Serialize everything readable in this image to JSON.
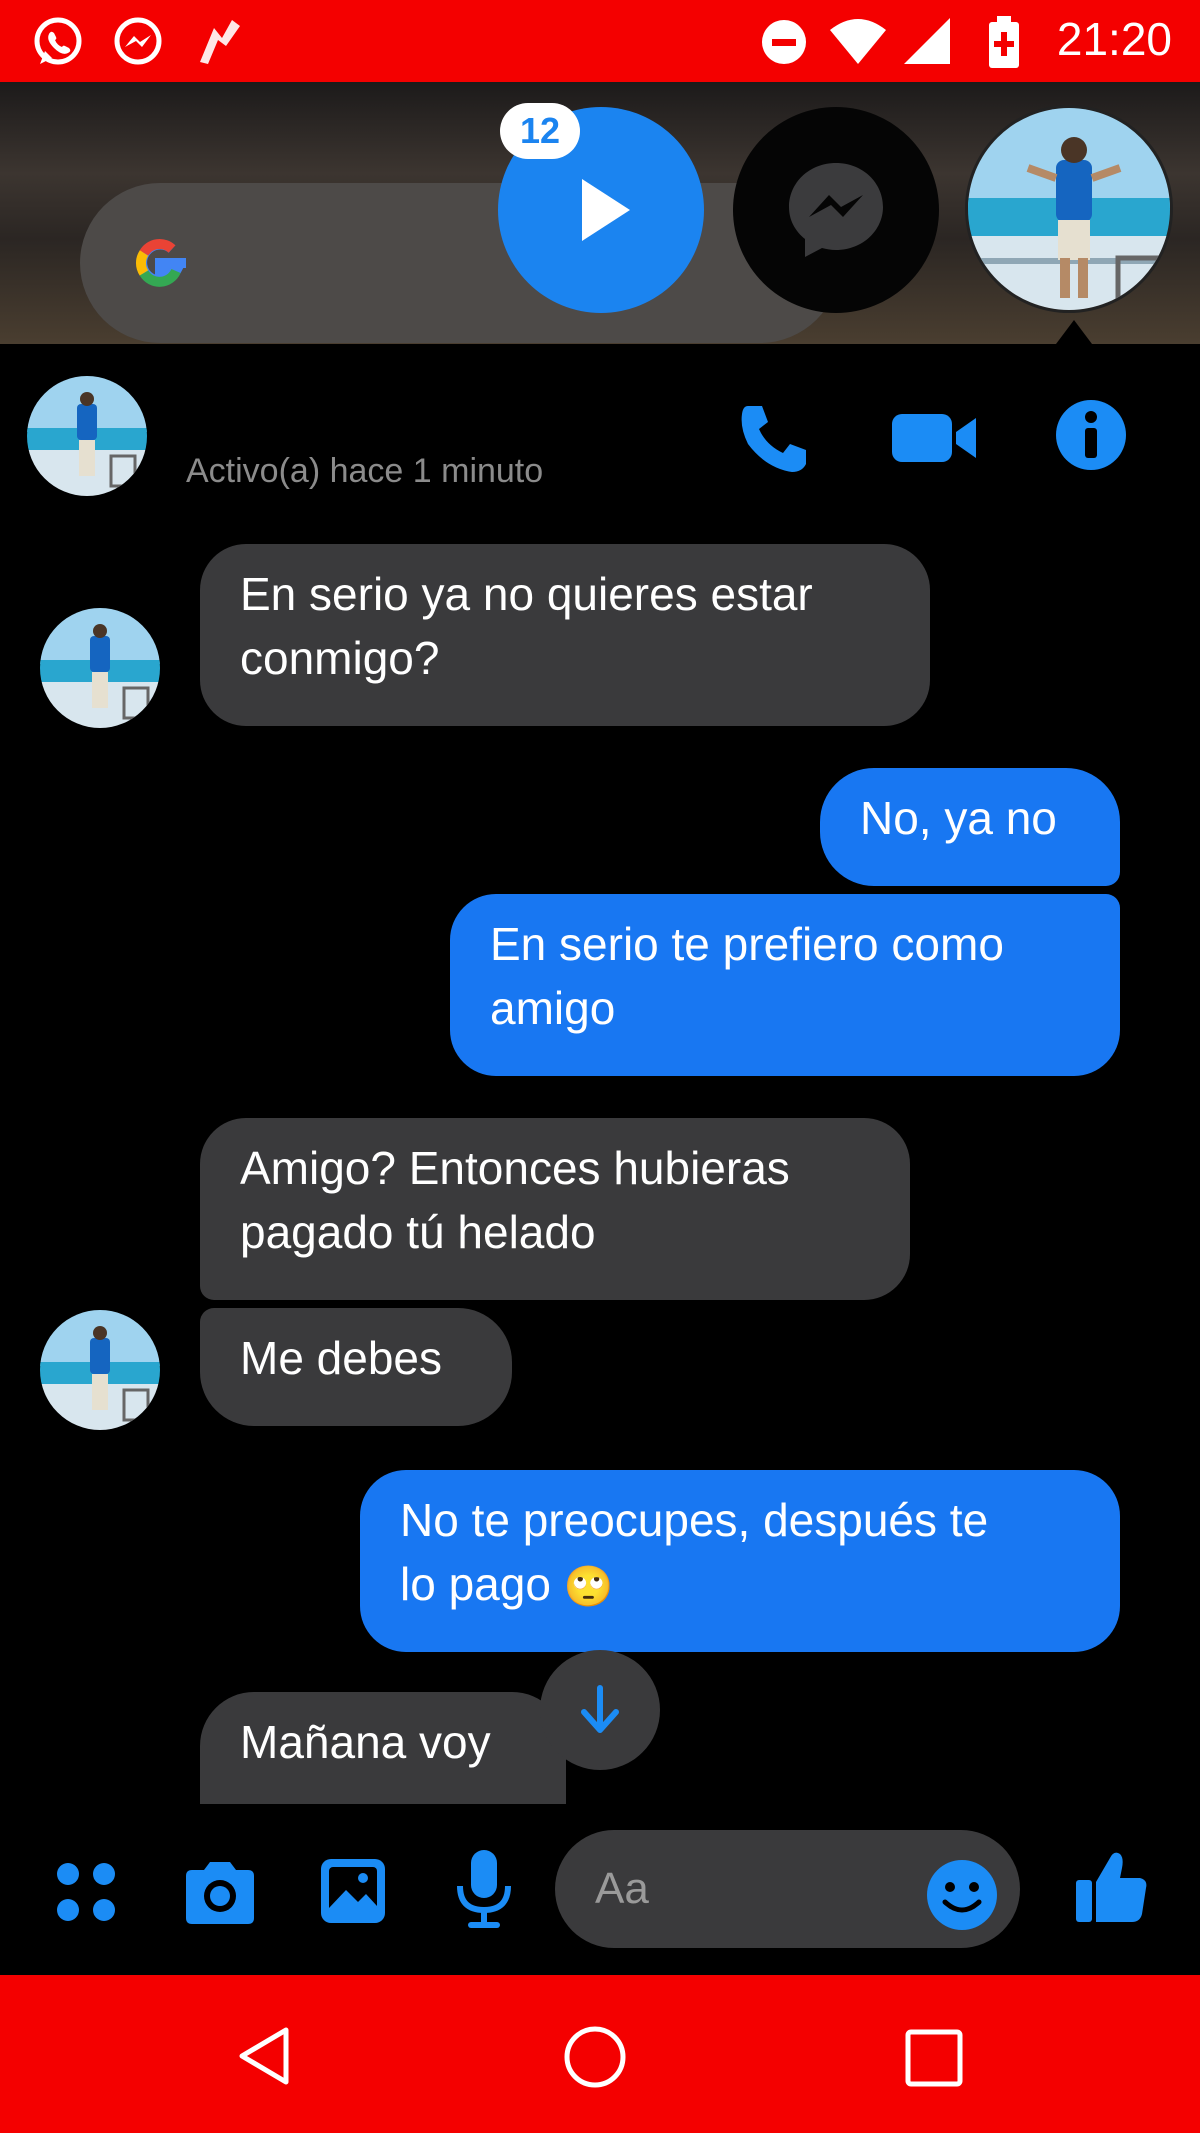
{
  "status_bar": {
    "time": "21:20",
    "left_icons": [
      "whatsapp-icon",
      "messenger-icon",
      "app-notification-icon"
    ],
    "right_icons": [
      "do-not-disturb-icon",
      "wifi-icon",
      "signal-icon",
      "battery-charging-icon"
    ],
    "color": "#f40000"
  },
  "home": {
    "search_logo": "google-logo-icon",
    "chat_heads": {
      "play_badge_count": "12"
    }
  },
  "chat": {
    "header": {
      "active_status": "Activo(a) hace 1 minuto",
      "actions": [
        "phone-icon",
        "video-call-icon",
        "info-icon"
      ]
    },
    "messages": [
      {
        "sender": "contact",
        "text_line1": "En serio ya no quieres estar",
        "text_line2": "conmigo?"
      },
      {
        "sender": "me",
        "text_line1": "No, ya no"
      },
      {
        "sender": "me",
        "text_line1": "En serio te prefiero como",
        "text_line2": "amigo"
      },
      {
        "sender": "contact",
        "text_line1": "Amigo? Entonces hubieras",
        "text_line2": "pagado tú helado"
      },
      {
        "sender": "contact",
        "text_line1": "Me debes"
      },
      {
        "sender": "me",
        "text_line1": "No te preocupes, después te",
        "text_line2": "lo pago",
        "emoji": "🙄"
      },
      {
        "sender": "contact",
        "text_line1": "Mañana voy"
      }
    ]
  },
  "composer": {
    "placeholder": "Aa",
    "tools": [
      "apps-icon",
      "camera-icon",
      "gallery-icon",
      "microphone-icon"
    ],
    "emoji_icon": "smiley-icon",
    "send_icon": "thumbs-up-icon"
  },
  "navbar": {
    "buttons": [
      "back-icon",
      "home-icon",
      "recents-icon"
    ]
  },
  "colors": {
    "accent": "#1877f2",
    "incoming_bubble": "#3a3a3c",
    "background": "#000000"
  }
}
